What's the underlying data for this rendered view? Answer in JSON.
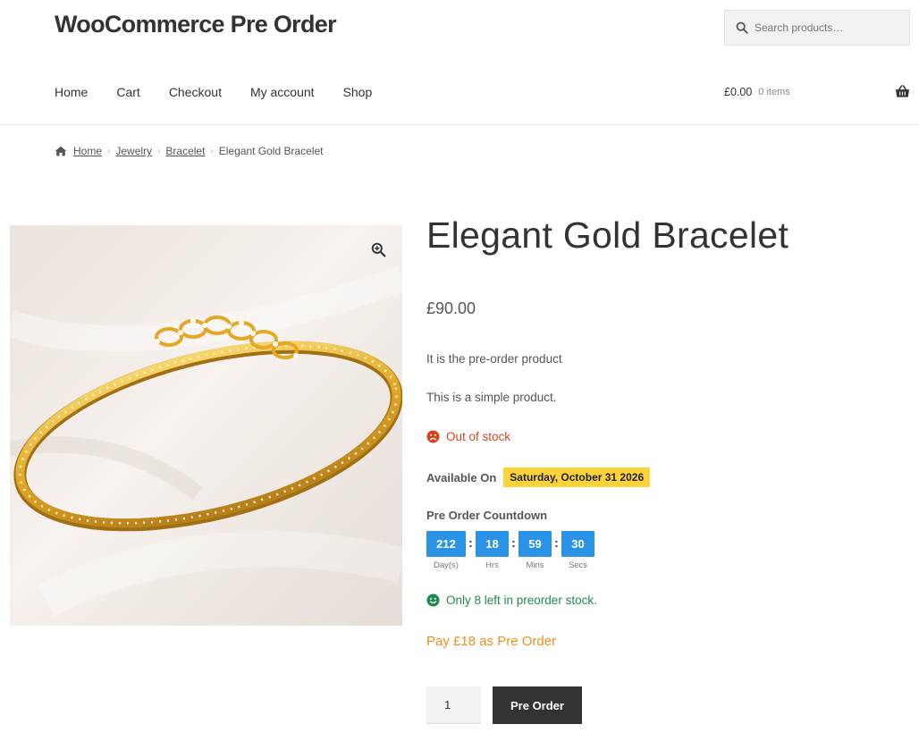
{
  "header": {
    "site_title": "WooCommerce Pre Order",
    "search": {
      "placeholder": "Search products…",
      "icon": "search-icon"
    },
    "nav": [
      "Home",
      "Cart",
      "Checkout",
      "My account",
      "Shop"
    ],
    "cart": {
      "amount": "£0.00",
      "count": "0 items",
      "icon": "basket-icon"
    }
  },
  "breadcrumb": {
    "items": [
      "Home",
      "Jewelry",
      "Bracelet"
    ],
    "current": "Elegant Gold Bracelet"
  },
  "product": {
    "title": "Elegant Gold Bracelet",
    "price": "£90.00",
    "descriptions": [
      "It is the pre-order product",
      "This is a simple product."
    ],
    "stock_status": "Out of stock",
    "available_label": "Available On",
    "available_date": "Saturday, October 31 2026",
    "countdown": {
      "title": "Pre Order Countdown",
      "units": [
        {
          "value": "212",
          "label": "Day(s)"
        },
        {
          "value": "18",
          "label": "Hrs"
        },
        {
          "value": "59",
          "label": "Mins"
        },
        {
          "value": "30",
          "label": "Secs"
        }
      ]
    },
    "preorder_stock": "Only 8 left in preorder stock.",
    "pay_text": "Pay £18 as Pre Order",
    "quantity": "1",
    "button_label": "Pre Order"
  },
  "colors": {
    "accent_blue": "#2a93e6",
    "date_badge": "#fcd33a",
    "out_of_stock": "#d2461f",
    "in_stock": "#1f8a50",
    "pay_orange": "#ec8f20",
    "button_dark": "#333333"
  }
}
